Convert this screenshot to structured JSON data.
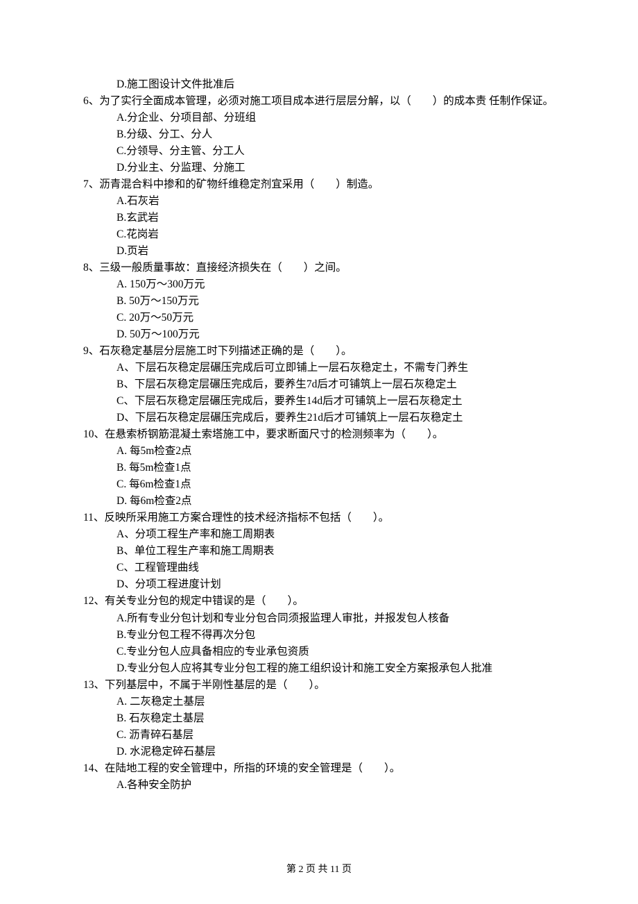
{
  "lines": {
    "q5_d": "D.施工图设计文件批准后",
    "q6": "6、为了实行全面成本管理，必须对施工项目成本进行层层分解，以（　　）的成本责 任制作保证。",
    "q6_a": "A.分企业、分项目部、分班组",
    "q6_b": "B.分级、分工、分人",
    "q6_c": "C.分领导、分主管、分工人",
    "q6_d": "D.分业主、分监理、分施工",
    "q7": "7、沥青混合料中掺和的矿物纤维稳定剂宜采用（　　）制造。",
    "q7_a": "A.石灰岩",
    "q7_b": "B.玄武岩",
    "q7_c": "C.花岗岩",
    "q7_d": "D.页岩",
    "q8": "8、三级一般质量事故：直接经济损失在（　　）之间。",
    "q8_a": "A. 150万～300万元",
    "q8_b": "B. 50万～150万元",
    "q8_c": "C. 20万～50万元",
    "q8_d": "D. 50万～100万元",
    "q9": "9、石灰稳定基层分层施工时下列描述正确的是（　　）。",
    "q9_a": "A、下层石灰稳定层碾压完成后可立即铺上一层石灰稳定土，不需专门养生",
    "q9_b": "B、下层石灰稳定层碾压完成后，要养生7d后才可铺筑上一层石灰稳定土",
    "q9_c": "C、下层石灰稳定层碾压完成后，要养生14d后才可铺筑上一层石灰稳定土",
    "q9_d": "D、下层石灰稳定层碾压完成后，要养生21d后才可铺筑上一层石灰稳定土",
    "q10": "10、在悬索桥钢筋混凝土索塔施工中，要求断面尺寸的检测频率为（　　）。",
    "q10_a": "A. 每5m检查2点",
    "q10_b": "B. 每5m检查1点",
    "q10_c": "C. 每6m检查1点",
    "q10_d": "D. 每6m检查2点",
    "q11": "11、反映所采用施工方案合理性的技术经济指标不包括（　　）。",
    "q11_a": "A、分项工程生产率和施工周期表",
    "q11_b": "B、单位工程生产率和施工周期表",
    "q11_c": "C、工程管理曲线",
    "q11_d": "D、分项工程进度计划",
    "q12": "12、有关专业分包的规定中错误的是（　　）。",
    "q12_a": "A.所有专业分包计划和专业分包合同须报监理人审批，并报发包人核备",
    "q12_b": "B.专业分包工程不得再次分包",
    "q12_c": "C.专业分包人应具备相应的专业承包资质",
    "q12_d": "D.专业分包人应将其专业分包工程的施工组织设计和施工安全方案报承包人批准",
    "q13": "13、下列基层中，不属于半刚性基层的是（　　）。",
    "q13_a": "A. 二灰稳定土基层",
    "q13_b": "B. 石灰稳定土基层",
    "q13_c": "C. 沥青碎石基层",
    "q13_d": "D. 水泥稳定碎石基层",
    "q14": "14、在陆地工程的安全管理中，所指的环境的安全管理是（　　）。",
    "q14_a": "A.各种安全防护"
  },
  "footer": "第 2 页 共 11 页"
}
